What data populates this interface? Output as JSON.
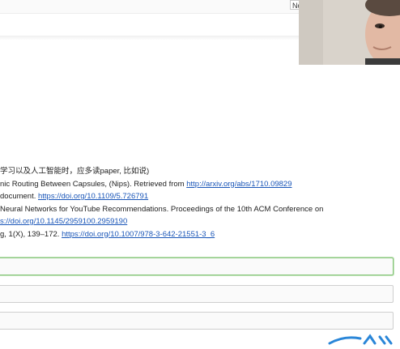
{
  "header": {
    "small_field_value": "Nc"
  },
  "references": [
    {
      "text": "学习以及人工智能时，应多读paper, 比如说)",
      "link": ""
    },
    {
      "text": "nic Routing Between Capsules, (Nips). Retrieved from ",
      "link": "http://arxiv.org/abs/1710.09829"
    },
    {
      "text": "document. ",
      "link": "https://doi.org/10.1109/5.726791"
    },
    {
      "text": "Neural Networks for YouTube Recommendations. Proceedings of the 10th ACM Conference on",
      "link": ""
    },
    {
      "text": "",
      "link": "s://doi.org/10.1145/2959100.2959190"
    },
    {
      "text": "g, 1(X), 139–172. ",
      "link": "https://doi.org/10.1007/978-3-642-21551-3_6"
    }
  ],
  "colors": {
    "link": "#1a56b8",
    "active_field_border": "#8bc77f",
    "logo_blue": "#2a86d8"
  },
  "icons": {
    "webcam": "webcam-overlay",
    "logo": "brand-logo"
  }
}
